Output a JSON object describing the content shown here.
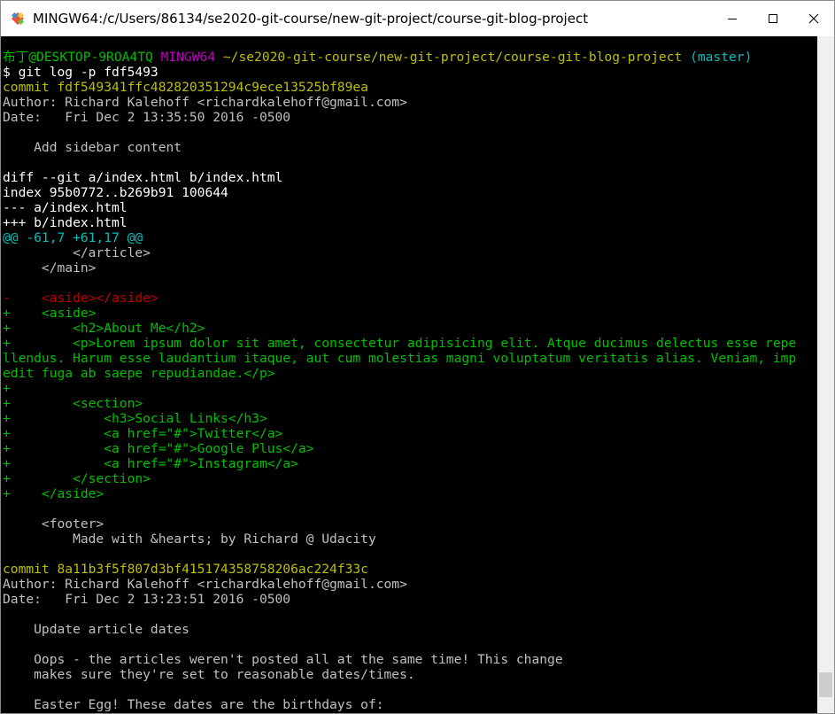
{
  "window": {
    "title": "MINGW64:/c/Users/86134/se2020-git-course/new-git-project/course-git-blog-project",
    "colors": {
      "green": "#00bf00",
      "magenta": "#bf00bf",
      "yellow": "#bfbf00",
      "cyan": "#00bfbf",
      "red": "#bf0000",
      "default": "#c0c0c0",
      "white": "#ffffff"
    }
  },
  "terminal": {
    "lines": [
      [
        {
          "t": "布丁@DESKTOP-9ROA4TQ",
          "c": "green"
        },
        {
          "t": " ",
          "c": "default"
        },
        {
          "t": "MINGW64",
          "c": "magenta"
        },
        {
          "t": " ",
          "c": "default"
        },
        {
          "t": "~/se2020-git-course/new-git-project/course-git-blog-project",
          "c": "yellow"
        },
        {
          "t": " ",
          "c": "default"
        },
        {
          "t": "(master)",
          "c": "cyan"
        }
      ],
      [
        {
          "t": "$ git log -p fdf5493",
          "c": "white"
        }
      ],
      [
        {
          "t": "commit fdf549341ffc482820351294c9ece13525bf89ea",
          "c": "yellow"
        }
      ],
      [
        {
          "t": "Author: Richard Kalehoff <richardkalehoff@gmail.com>",
          "c": "default"
        }
      ],
      [
        {
          "t": "Date:   Fri Dec 2 13:35:50 2016 -0500",
          "c": "default"
        }
      ],
      [
        {
          "t": "",
          "c": "default"
        }
      ],
      [
        {
          "t": "    Add sidebar content",
          "c": "default"
        }
      ],
      [
        {
          "t": "",
          "c": "default"
        }
      ],
      [
        {
          "t": "diff --git a/index.html b/index.html",
          "c": "white"
        }
      ],
      [
        {
          "t": "index 95b0772..b269b91 100644",
          "c": "white"
        }
      ],
      [
        {
          "t": "--- a/index.html",
          "c": "white"
        }
      ],
      [
        {
          "t": "+++ b/index.html",
          "c": "white"
        }
      ],
      [
        {
          "t": "@@ -61,7 +61,17 @@",
          "c": "cyan"
        }
      ],
      [
        {
          "t": "         </article>",
          "c": "default"
        }
      ],
      [
        {
          "t": "     </main>",
          "c": "default"
        }
      ],
      [
        {
          "t": "",
          "c": "default"
        }
      ],
      [
        {
          "t": "-    <aside></aside>",
          "c": "red"
        }
      ],
      [
        {
          "t": "+    <aside>",
          "c": "green"
        }
      ],
      [
        {
          "t": "+        <h2>About Me</h2>",
          "c": "green"
        }
      ],
      [
        {
          "t": "+        <p>Lorem ipsum dolor sit amet, consectetur adipisicing elit. Atque ducimus delectus esse repe",
          "c": "green"
        }
      ],
      [
        {
          "t": "llendus. Harum esse laudantium itaque, aut cum molestias magni voluptatum veritatis alias. Veniam, imp",
          "c": "green"
        }
      ],
      [
        {
          "t": "edit fuga ab saepe repudiandae.</p>",
          "c": "green"
        }
      ],
      [
        {
          "t": "+",
          "c": "green"
        }
      ],
      [
        {
          "t": "+        <section>",
          "c": "green"
        }
      ],
      [
        {
          "t": "+            <h3>Social Links</h3>",
          "c": "green"
        }
      ],
      [
        {
          "t": "+            <a href=\"#\">Twitter</a>",
          "c": "green"
        }
      ],
      [
        {
          "t": "+            <a href=\"#\">Google Plus</a>",
          "c": "green"
        }
      ],
      [
        {
          "t": "+            <a href=\"#\">Instagram</a>",
          "c": "green"
        }
      ],
      [
        {
          "t": "+        </section>",
          "c": "green"
        }
      ],
      [
        {
          "t": "+    </aside>",
          "c": "green"
        }
      ],
      [
        {
          "t": "",
          "c": "default"
        }
      ],
      [
        {
          "t": "     <footer>",
          "c": "default"
        }
      ],
      [
        {
          "t": "         Made with &hearts; by Richard @ Udacity",
          "c": "default"
        }
      ],
      [
        {
          "t": "",
          "c": "default"
        }
      ],
      [
        {
          "t": "commit 8a11b3f5f807d3bf415174358758206ac224f33c",
          "c": "yellow"
        }
      ],
      [
        {
          "t": "Author: Richard Kalehoff <richardkalehoff@gmail.com>",
          "c": "default"
        }
      ],
      [
        {
          "t": "Date:   Fri Dec 2 13:23:51 2016 -0500",
          "c": "default"
        }
      ],
      [
        {
          "t": "",
          "c": "default"
        }
      ],
      [
        {
          "t": "    Update article dates",
          "c": "default"
        }
      ],
      [
        {
          "t": "",
          "c": "default"
        }
      ],
      [
        {
          "t": "    Oops - the articles weren't posted all at the same time! This change",
          "c": "default"
        }
      ],
      [
        {
          "t": "    makes sure they're set to reasonable dates/times.",
          "c": "default"
        }
      ],
      [
        {
          "t": "",
          "c": "default"
        }
      ],
      [
        {
          "t": "    Easter Egg! These dates are the birthdays of:",
          "c": "default"
        }
      ]
    ]
  }
}
